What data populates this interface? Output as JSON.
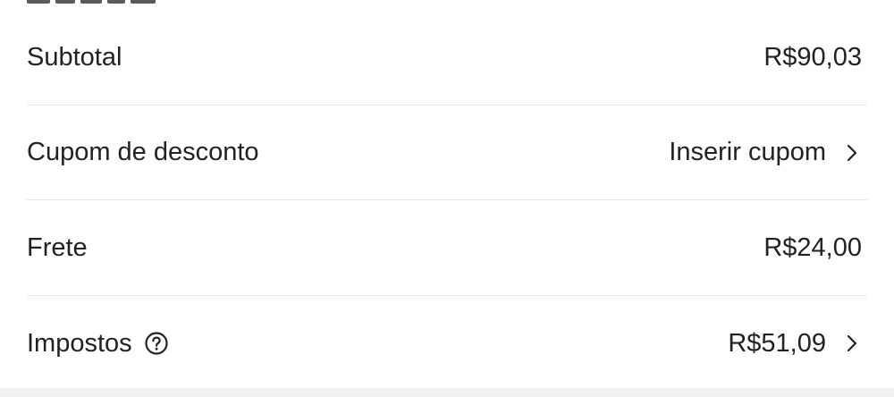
{
  "summary": {
    "rows": [
      {
        "label": "Subtotal",
        "value": "R$90,03"
      },
      {
        "label": "Cupom de desconto",
        "value": "Inserir cupom"
      },
      {
        "label": "Frete",
        "value": "R$24,00"
      },
      {
        "label": "Impostos",
        "value": "R$51,09"
      }
    ]
  },
  "icons": {
    "help": "question-circle-icon",
    "chevron": "chevron-right-icon"
  },
  "colors": {
    "text": "#222222",
    "divider": "#e8e8e8",
    "footer_bg": "#f1f1f1"
  }
}
